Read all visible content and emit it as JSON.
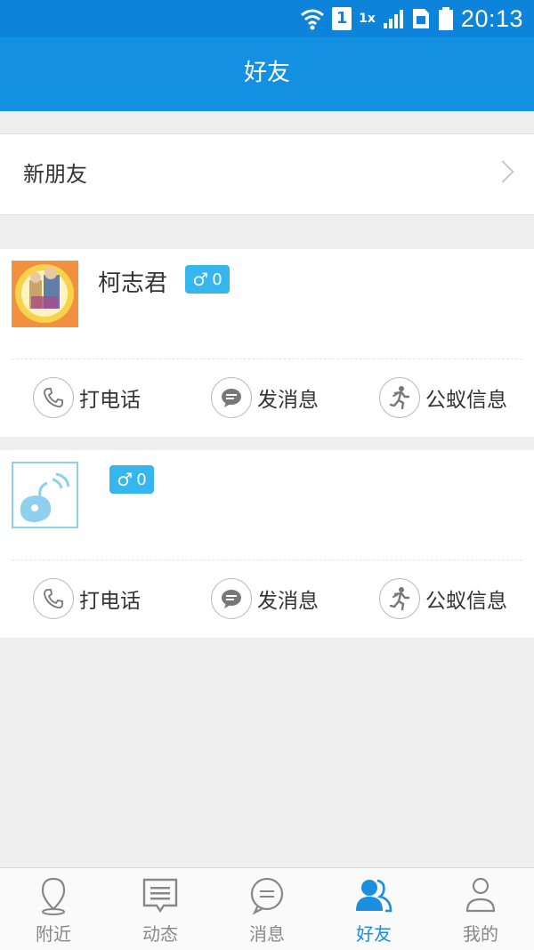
{
  "status": {
    "time": "20:13",
    "sim": "1",
    "network": "1x"
  },
  "header": {
    "title": "好友"
  },
  "new_friends": {
    "label": "新朋友"
  },
  "friends": [
    {
      "name": "柯志君",
      "gender_symbol": "♂",
      "count": "0"
    },
    {
      "name": "",
      "gender_symbol": "♂",
      "count": "0"
    }
  ],
  "actions": {
    "call": "打电话",
    "message": "发消息",
    "info": "公蚁信息"
  },
  "tabs": [
    {
      "label": "附近",
      "icon": "location-pin-icon"
    },
    {
      "label": "动态",
      "icon": "feed-icon"
    },
    {
      "label": "消息",
      "icon": "chat-bubble-icon"
    },
    {
      "label": "好友",
      "icon": "friends-icon",
      "active": true
    },
    {
      "label": "我的",
      "icon": "person-icon"
    }
  ],
  "colors": {
    "brand": "#1490e3",
    "gender_badge": "#35b6ef",
    "tab_active": "#1b8ee0"
  }
}
